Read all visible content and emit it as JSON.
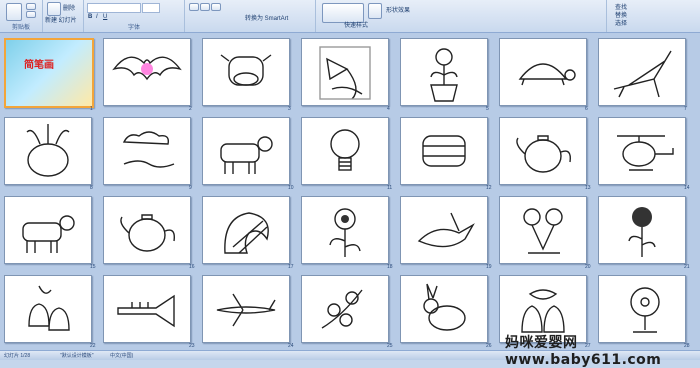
{
  "ribbon": {
    "groups": [
      {
        "key": "clipboard",
        "label": "剪贴板"
      },
      {
        "key": "slides",
        "label": ""
      },
      {
        "key": "font",
        "label": "字体"
      },
      {
        "key": "paragraph",
        "label": ""
      },
      {
        "key": "drawing",
        "label": ""
      },
      {
        "key": "editing",
        "label": ""
      }
    ],
    "new_slide": "新建\n幻灯片",
    "delete": "删除",
    "smartart": "转换为 SmartArt",
    "quick_styles": "快速样式",
    "shape_effects": "形状效果",
    "find": "查找",
    "replace": "替换",
    "select": "选择"
  },
  "slides": [
    {
      "n": "1",
      "title": "简笔画",
      "subject": "title"
    },
    {
      "n": "2",
      "subject": "bat"
    },
    {
      "n": "3",
      "subject": "cow face"
    },
    {
      "n": "4",
      "subject": "morning glory"
    },
    {
      "n": "5",
      "subject": "potted flower"
    },
    {
      "n": "6",
      "subject": "turtle"
    },
    {
      "n": "7",
      "subject": "deck chair"
    },
    {
      "n": "8",
      "subject": "radish"
    },
    {
      "n": "9",
      "subject": "clouds"
    },
    {
      "n": "10",
      "subject": "cow"
    },
    {
      "n": "11",
      "subject": "light bulb"
    },
    {
      "n": "12",
      "subject": "towel"
    },
    {
      "n": "13",
      "subject": "teapot"
    },
    {
      "n": "14",
      "subject": "helicopter"
    },
    {
      "n": "15",
      "subject": "cow"
    },
    {
      "n": "16",
      "subject": "teapot"
    },
    {
      "n": "17",
      "subject": "shell"
    },
    {
      "n": "18",
      "subject": "sunflower"
    },
    {
      "n": "19",
      "subject": "bird"
    },
    {
      "n": "20",
      "subject": "flowers"
    },
    {
      "n": "21",
      "subject": "rose"
    },
    {
      "n": "22",
      "subject": "bells"
    },
    {
      "n": "23",
      "subject": "trumpet"
    },
    {
      "n": "24",
      "subject": "airplane"
    },
    {
      "n": "25",
      "subject": "blossoms"
    },
    {
      "n": "26",
      "subject": "rabbit"
    },
    {
      "n": "27",
      "subject": "bells with bow"
    },
    {
      "n": "28",
      "subject": "fan"
    }
  ],
  "status": {
    "slide_info": "幻灯片 1/28",
    "theme": "\"默认设计模板\"",
    "language": "中文(中国)"
  },
  "watermark": "妈咪爱婴网 www.baby611.com"
}
